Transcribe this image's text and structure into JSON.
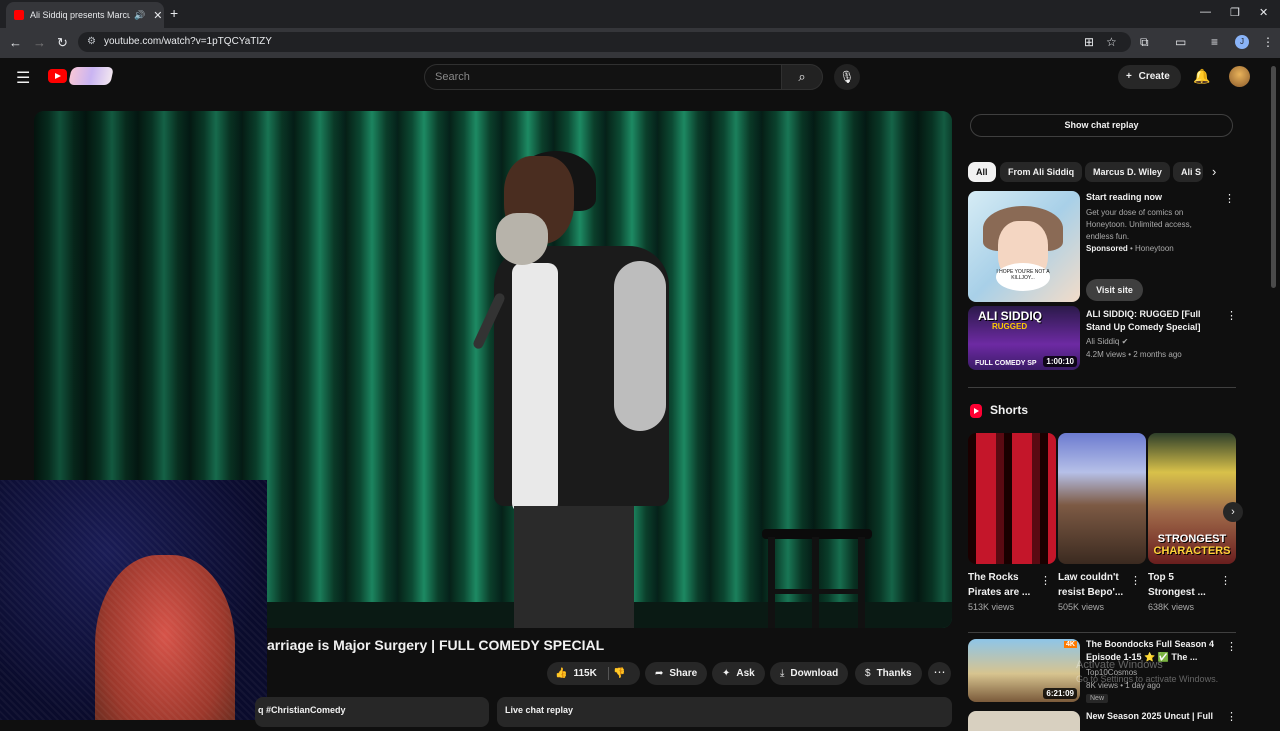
{
  "browser": {
    "tab_title": "Ali Siddiq presents Marcus",
    "new_tab": "+",
    "url": "youtube.com/watch?v=1pTQCYaTIZY",
    "profile_initial": "J"
  },
  "header": {
    "search_placeholder": "Search",
    "create_label": "Create"
  },
  "video": {
    "title": "arriage is Major Surgery | FULL COMEDY SPECIAL",
    "actions": {
      "likes": "115K",
      "share": "Share",
      "ask": "Ask",
      "download": "Download",
      "thanks": "Thanks"
    },
    "description_snippet": "q #ChristianComedy",
    "live_chat_replay": "Live chat replay"
  },
  "sidebar": {
    "show_chat_replay": "Show chat replay",
    "chips": [
      "All",
      "From Ali Siddiq",
      "Marcus D. Wiley",
      "Ali S"
    ],
    "ad": {
      "title": "Start reading now",
      "description": "Get your dose of comics on Honeytoon. Unlimited access, endless fun.",
      "sponsored": "Sponsored",
      "advertiser": "Honeytoon",
      "cta": "Visit site",
      "bubble_text": "I HOPE YOU'RE NOT A KILLJOY..."
    },
    "video1": {
      "thumb_text_1": "ALI SIDDIQ",
      "thumb_text_2": "RUGGED",
      "thumb_text_3": "FULL COMEDY SP",
      "duration": "1:00:10",
      "title": "ALI SIDDIQ: RUGGED [Full Stand Up Comedy Special]",
      "channel": "Ali Siddiq",
      "meta": "4.2M views • 2 months ago"
    },
    "shorts": {
      "label": "Shorts",
      "items": [
        {
          "title": "The Rocks Pirates are ...",
          "views": "513K views"
        },
        {
          "title": "Law couldn't resist Bepo'...",
          "views": "505K views"
        },
        {
          "title": "Top 5 Strongest ...",
          "views": "638K views"
        }
      ],
      "short3_caption_1": "STRONGEST",
      "short3_caption_2": "CHARACTERS"
    },
    "video2": {
      "badge": "4K",
      "duration": "6:21:09",
      "title": "The Boondocks Full Season 4 Episode 1-15 ⭐ ✅ The ...",
      "channel": "Top10Cosmos",
      "meta": "8K views • 1 day ago",
      "new_badge": "New"
    },
    "video3": {
      "title": "New Season 2025 Uncut | Full"
    }
  },
  "watermark": {
    "line1": "Activate Windows",
    "line2": "Go to Settings to activate Windows."
  }
}
